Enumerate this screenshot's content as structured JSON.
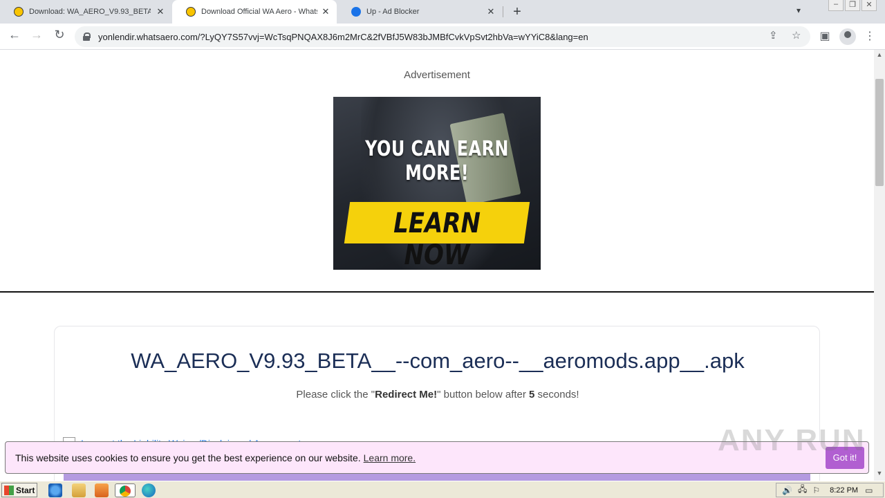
{
  "browser": {
    "tabs": [
      {
        "title": "Download: WA_AERO_V9.93_BETA_",
        "active": false
      },
      {
        "title": "Download Official WA Aero - WhatsA",
        "active": true
      },
      {
        "title": "Up - Ad Blocker",
        "active": false
      }
    ],
    "url": "yonlendir.whatsaero.com/?LyQY7S57vvj=WcTsqPNQAX8J6m2MrC&2fVBfJ5W83bJMBfCvkVpSvt2hbVa=wYYiC8&lang=en"
  },
  "page": {
    "ad_label": "Advertisement",
    "ad_headline": "YOU CAN EARN MORE!",
    "ad_cta": "LEARN NOW",
    "file_title": "WA_AERO_V9.93_BETA__--com_aero--__aeromods.app__.apk",
    "sub_before": "Please click the \"",
    "sub_bold": "Redirect Me!",
    "sub_middle": "\" button below after ",
    "sub_count": "5",
    "sub_after": " seconds!",
    "agree_text": "I accept the Liability Waiver/Disclaimer | Agreement",
    "cookie_text": "This website uses cookies to ensure you get the best experience on our website.",
    "cookie_link": "Learn more.",
    "cookie_button": "Got it!",
    "watermark": "ANY RUN"
  },
  "taskbar": {
    "start_label": "Start",
    "clock": "8:22 PM"
  },
  "colors": {
    "title_color": "#1b2e56",
    "cookie_bg": "#fde6fb",
    "cookie_button": "#b15fd1",
    "ad_cta_bg": "#f5d10c"
  }
}
